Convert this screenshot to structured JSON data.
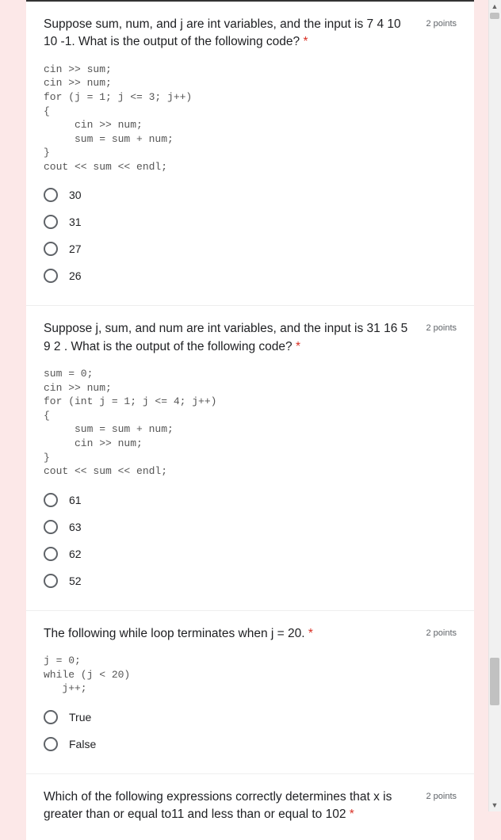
{
  "questions": [
    {
      "text": "Suppose sum, num, and j are int variables, and the input is 7 4 10 10 -1. What is the output of the following code?",
      "points": "2 points",
      "code": "cin >> sum;\ncin >> num;\nfor (j = 1; j <= 3; j++)\n{\n     cin >> num;\n     sum = sum + num;\n}\ncout << sum << endl;",
      "options": [
        "30",
        "31",
        "27",
        "26"
      ]
    },
    {
      "text": "Suppose j, sum, and num are int variables, and the input is 31 16 5 9 2 . What is the output of the following code?",
      "points": "2 points",
      "code": "sum = 0;\ncin >> num;\nfor (int j = 1; j <= 4; j++)\n{\n     sum = sum + num;\n     cin >> num;\n}\ncout << sum << endl;",
      "options": [
        "61",
        "63",
        "62",
        "52"
      ]
    },
    {
      "text": "The following while loop terminates when j = 20.",
      "points": "2 points",
      "code": "j = 0;\nwhile (j < 20)\n   j++;",
      "options": [
        "True",
        "False"
      ]
    },
    {
      "text": "Which of the following expressions correctly determines that x is greater than or equal to11 and less than or equal to 102",
      "points": "2 points",
      "code": "",
      "options": []
    }
  ],
  "required_marker": "*"
}
